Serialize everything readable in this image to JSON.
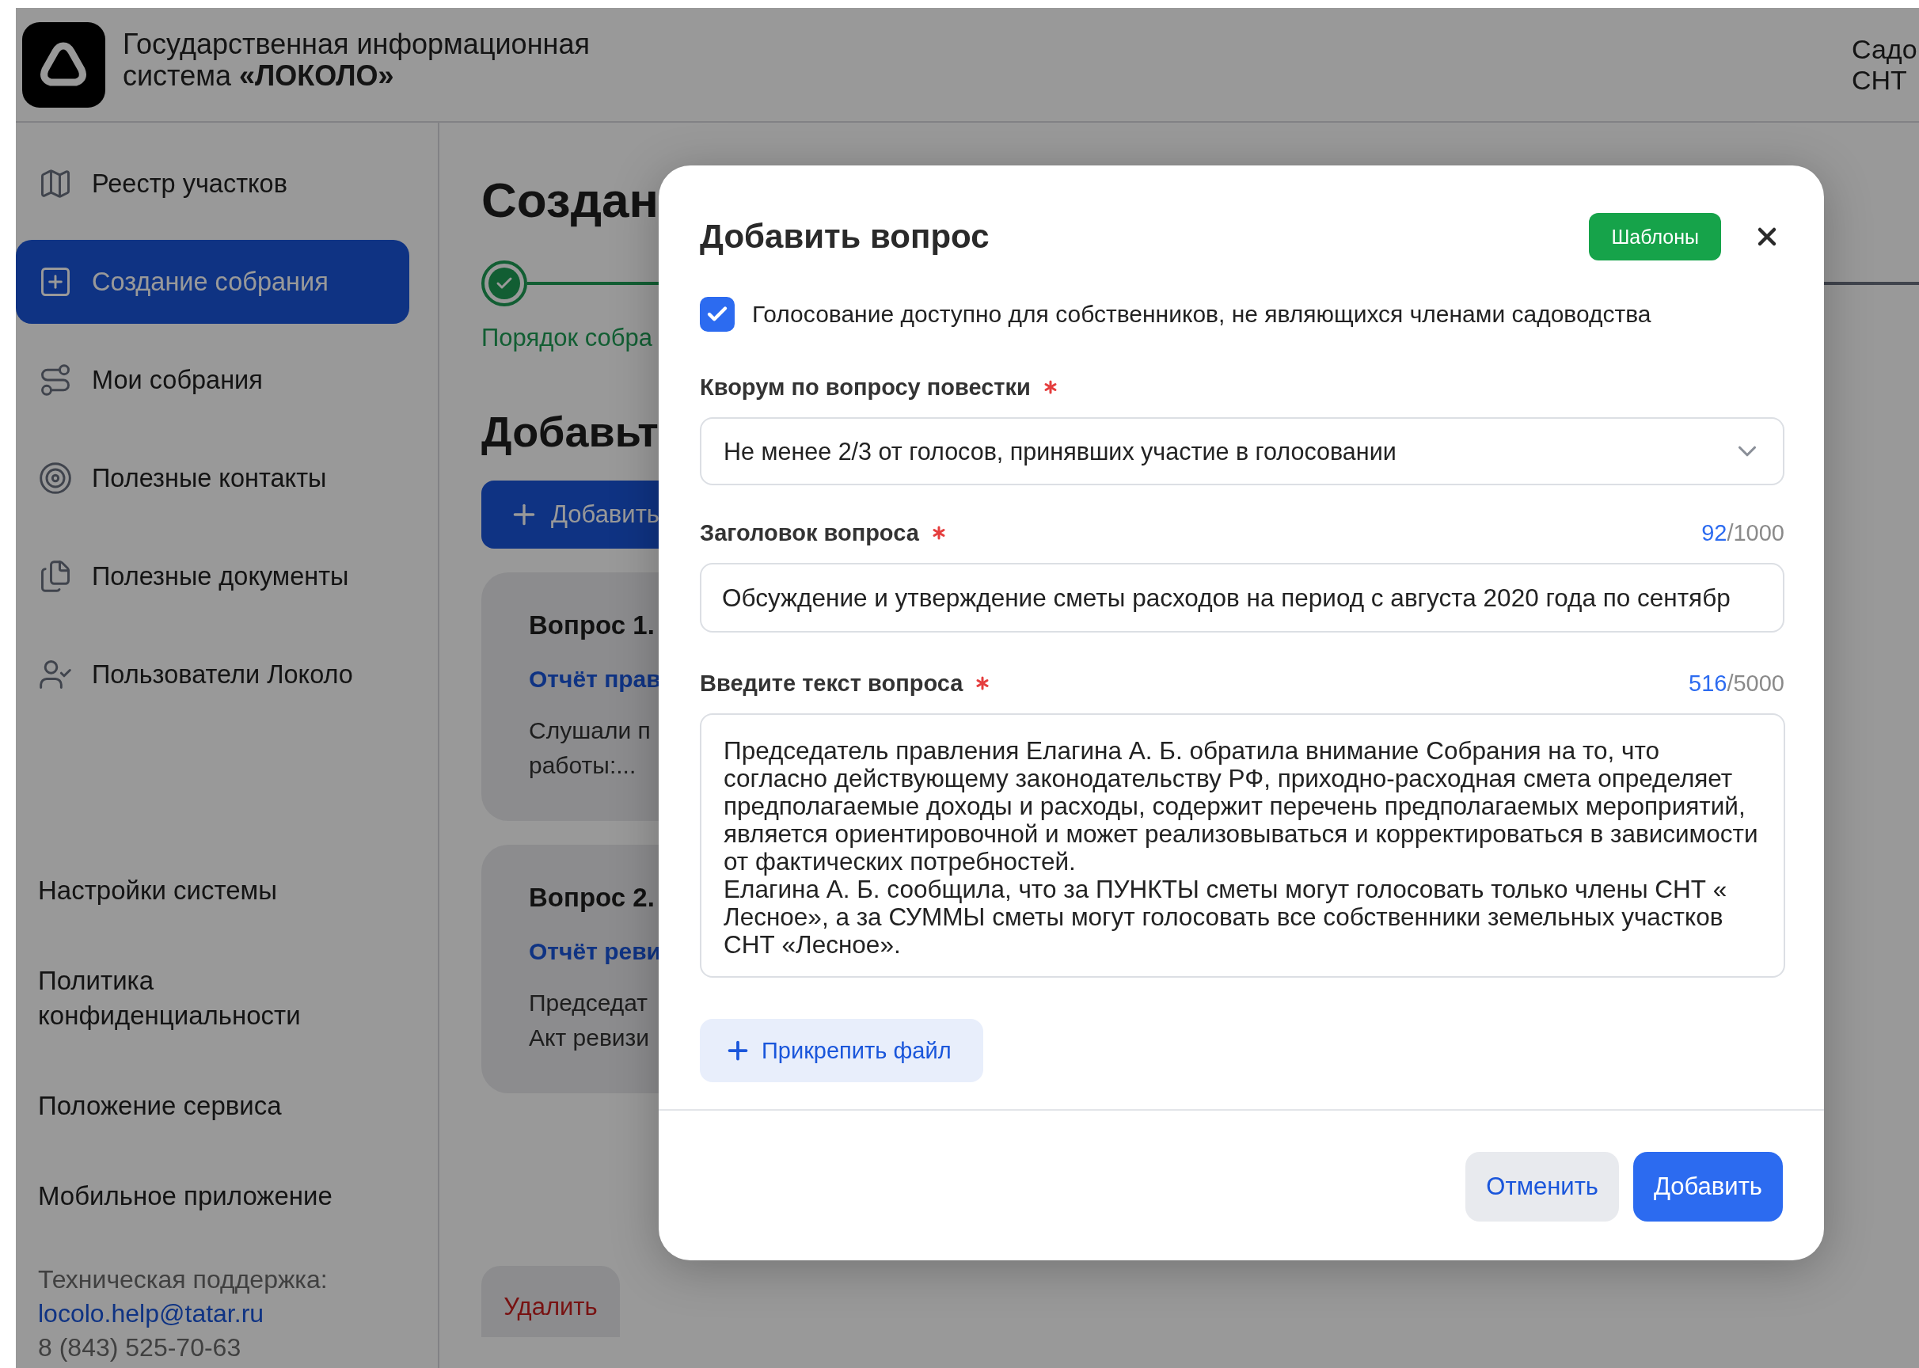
{
  "header": {
    "system_line1": "Государственная информационная",
    "system_line2": "система **«ЛОКОЛО»**",
    "org_lines": [
      "Садо",
      "СНТ"
    ]
  },
  "sidebar": {
    "items": [
      {
        "label": "Реестр участков",
        "selected": false
      },
      {
        "label": "Создание собрания",
        "selected": true
      },
      {
        "label": "Мои собрания",
        "selected": false
      },
      {
        "label": "Полезные контакты",
        "selected": false
      },
      {
        "label": "Полезные документы",
        "selected": false
      },
      {
        "label": "Пользователи Локоло",
        "selected": false
      }
    ],
    "links": [
      "Настройки системы",
      "Политика конфиденциальности",
      "Положение сервиса",
      "Мобильное приложение"
    ],
    "support": {
      "label": "Техническая поддержка:",
      "email": "locolo.help@tatar.ru",
      "phone": "8 (843) 525-70-63"
    }
  },
  "main": {
    "title": "Создан",
    "steps": [
      {
        "label": "Порядок собра",
        "completed": true
      }
    ],
    "add_heading": "Добавьт",
    "add_button": "Добавить",
    "questions": [
      {
        "title": "Вопрос 1.",
        "link": "Отчёт прав",
        "lines": [
          "Слушали п",
          "работы:..."
        ]
      },
      {
        "title": "Вопрос 2.",
        "link": "Отчёт реви",
        "lines": [
          "Председат",
          "Акт ревизи"
        ]
      }
    ],
    "delete_button": "Удалить"
  },
  "modal": {
    "title": "Добавить вопрос",
    "templates_button": "Шаблоны",
    "checkbox": {
      "label": "Голосование доступно для собственников, не являющихся членами садоводства",
      "checked": true
    },
    "quorum": {
      "label": "Кворум по вопросу повестки",
      "required": true,
      "value": "Не менее 2/3 от голосов, принявших участие в голосовании"
    },
    "question_title": {
      "label": "Заголовок вопроса",
      "required": true,
      "count": "92",
      "limit": "/1000",
      "value": "Обсуждение и утверждение сметы расходов на период с августа 2020 года по сентябр"
    },
    "question_text": {
      "label": "Введите текст вопроса",
      "required": true,
      "count": "516",
      "limit": "/5000",
      "value": "Председатель правления Елагина А. Б. обратила внимание Собрания на то, что согласно действующему законодательству РФ, приходно-расходная смета определяет предполагаемые доходы и расходы, содержит перечень предполагаемых мероприятий, является ориентировочной и может реализовываться и корректироваться в зависимости от фактических потребностей.\nЕлагина А. Б. сообщила, что за ПУНКТЫ сметы могут голосовать только члены СНТ « Лесное», а за СУММЫ сметы могут голосовать все собственники земельных участков СНТ «Лесное»."
    },
    "attach_button": "Прикрепить файл",
    "cancel_button": "Отменить",
    "submit_button": "Добавить"
  }
}
